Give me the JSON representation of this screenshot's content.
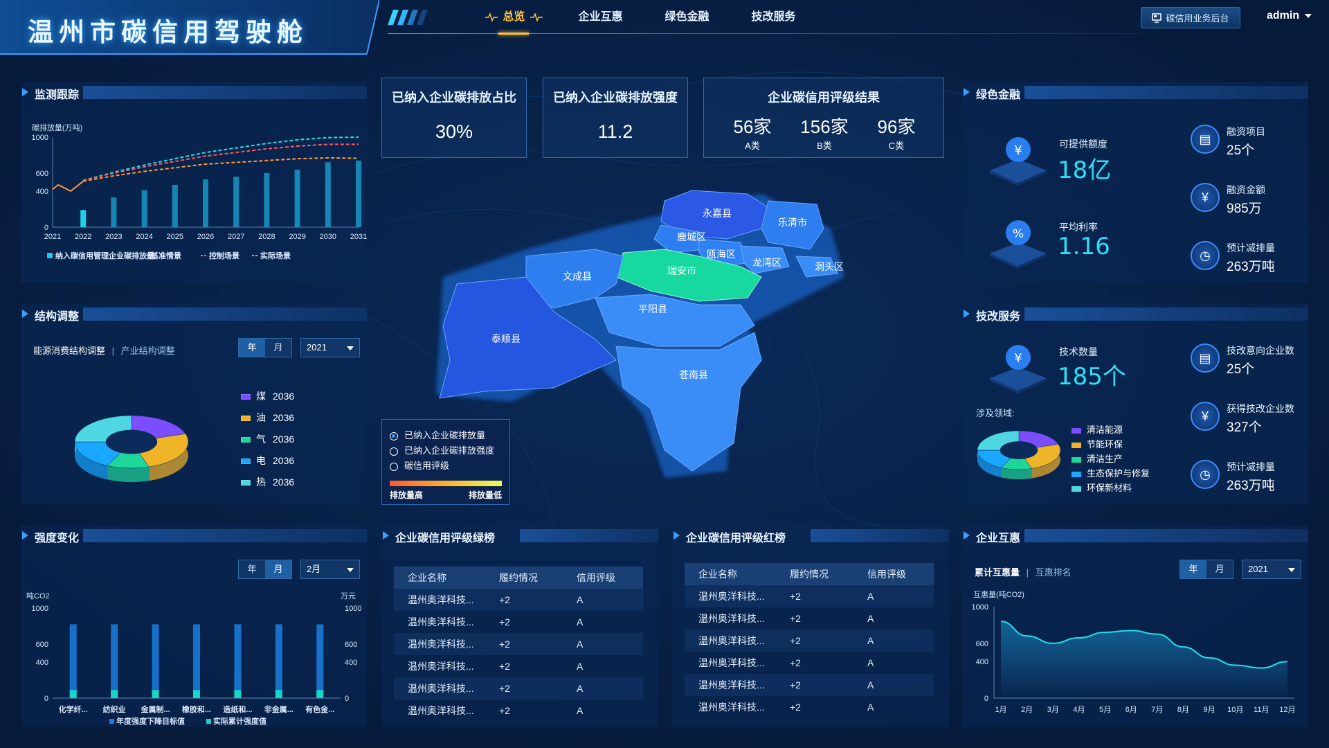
{
  "header": {
    "title": "温州市碳信用驾驶舱",
    "nav": [
      {
        "label": "总览",
        "active": true
      },
      {
        "label": "企业互惠",
        "active": false
      },
      {
        "label": "绿色金融",
        "active": false
      },
      {
        "label": "技改服务",
        "active": false
      }
    ],
    "backend_button": "碳信用业务后台",
    "user": "admin"
  },
  "monitor": {
    "title": "监测跟踪",
    "ylabel": "碳排放量(万吨)",
    "yticks": [
      "1000",
      "600",
      "400",
      "0"
    ],
    "legend": [
      "纳入碳信用管理企业碳排放量",
      "基准情景",
      "控制场景",
      "实际场景"
    ]
  },
  "structure": {
    "title": "结构调整",
    "tab_active": "能源消费结构调整",
    "tab_inactive": "产业结构调整",
    "toggle": [
      "年",
      "月"
    ],
    "year": "2021",
    "legend": [
      {
        "label": "煤",
        "year": "2036",
        "color": "#7b4dff"
      },
      {
        "label": "油",
        "year": "2036",
        "color": "#f0b429"
      },
      {
        "label": "气",
        "year": "2036",
        "color": "#1fd69a"
      },
      {
        "label": "电",
        "year": "2036",
        "color": "#1aa7ff"
      },
      {
        "label": "热",
        "year": "2036",
        "color": "#4fd6e3"
      }
    ]
  },
  "intensity": {
    "title": "强度变化",
    "toggle": [
      "年",
      "月"
    ],
    "month": "2月",
    "ylabel_left": "吨CO2",
    "ylabel_right": "万元",
    "yticks_left": [
      "1000",
      "600",
      "400",
      "0"
    ],
    "yticks_right": [
      "1000",
      "600",
      "400",
      "0"
    ],
    "legend": [
      "年度强度下降目标值",
      "实际累计强度值"
    ]
  },
  "stats": {
    "share": {
      "title": "已纳入企业碳排放占比",
      "value": "30%"
    },
    "intensity": {
      "title": "已纳入企业碳排放强度",
      "value": "11.2"
    },
    "rating": {
      "title": "企业碳信用评级结果",
      "items": [
        {
          "value": "56家",
          "label": "A类"
        },
        {
          "value": "156家",
          "label": "B类"
        },
        {
          "value": "96家",
          "label": "C类"
        }
      ]
    }
  },
  "map": {
    "regions": [
      "永嘉县",
      "乐清市",
      "鹿城区",
      "瓯海区",
      "龙湾区",
      "洞头区",
      "瑞安市",
      "文成县",
      "平阳县",
      "泰顺县",
      "苍南县"
    ],
    "legend_options": [
      {
        "label": "已纳入企业碳排放量",
        "selected": true
      },
      {
        "label": "已纳入企业碳排放强度",
        "selected": false
      },
      {
        "label": "碳信用评级",
        "selected": false
      }
    ],
    "gradient_high": "排放量高",
    "gradient_low": "排放量低"
  },
  "green_list": {
    "title": "企业碳信用评级绿榜",
    "headers": [
      "企业名称",
      "履约情况",
      "信用评级"
    ],
    "rows": [
      [
        "温州奥洋科技...",
        "+2",
        "A"
      ],
      [
        "温州奥洋科技...",
        "+2",
        "A"
      ],
      [
        "温州奥洋科技...",
        "+2",
        "A"
      ],
      [
        "温州奥洋科技...",
        "+2",
        "A"
      ],
      [
        "温州奥洋科技...",
        "+2",
        "A"
      ],
      [
        "温州奥洋科技...",
        "+2",
        "A"
      ]
    ]
  },
  "red_list": {
    "title": "企业碳信用评级红榜",
    "headers": [
      "企业名称",
      "履约情况",
      "信用评级"
    ],
    "rows": [
      [
        "温州奥洋科技...",
        "+2",
        "A"
      ],
      [
        "温州奥洋科技...",
        "+2",
        "A"
      ],
      [
        "温州奥洋科技...",
        "+2",
        "A"
      ],
      [
        "温州奥洋科技...",
        "+2",
        "A"
      ],
      [
        "温州奥洋科技...",
        "+2",
        "A"
      ],
      [
        "温州奥洋科技...",
        "+2",
        "A"
      ]
    ]
  },
  "green_finance": {
    "title": "绿色金融",
    "credit_label": "可提供额度",
    "credit_value": "18亿",
    "rate_label": "平均利率",
    "rate_value": "1.16",
    "projects_label": "融资项目",
    "projects_value": "25个",
    "amount_label": "融资金额",
    "amount_value": "985万",
    "reduction_label": "预计减排量",
    "reduction_value": "263万吨"
  },
  "tech_service": {
    "title": "技改服务",
    "count_label": "技术数量",
    "count_value": "185个",
    "fields_label": "涉及领域:",
    "fields": [
      {
        "label": "清洁能源",
        "color": "#7b4dff"
      },
      {
        "label": "节能环保",
        "color": "#f0b429"
      },
      {
        "label": "清洁生产",
        "color": "#1fd69a"
      },
      {
        "label": "生态保护与修复",
        "color": "#1aa7ff"
      },
      {
        "label": "环保新材料",
        "color": "#4fd6e3"
      }
    ],
    "intent_label": "技改意向企业数",
    "intent_value": "25个",
    "got_label": "获得技改企业数",
    "got_value": "327个",
    "reduction_label": "预计减排量",
    "reduction_value": "263万吨"
  },
  "mutual": {
    "title": "企业互惠",
    "tab_active": "累计互惠量",
    "tab_inactive": "互惠排名",
    "toggle": [
      "年",
      "月"
    ],
    "year": "2021",
    "ylabel": "互惠量(吨CO2)",
    "yticks": [
      "1000",
      "600",
      "400",
      "0"
    ]
  },
  "chart_data": [
    {
      "type": "line",
      "title": "监测跟踪",
      "ylabel": "碳排放量(万吨)",
      "x": [
        "2021",
        "2022",
        "2023",
        "2024",
        "2025",
        "2026",
        "2027",
        "2028",
        "2029",
        "2030",
        "2031"
      ],
      "ylim": [
        0,
        1000
      ],
      "series": [
        {
          "name": "纳入碳信用管理企业碳排放量",
          "kind": "bar",
          "color": "#1fc6e8",
          "values": [
            null,
            190,
            330,
            410,
            470,
            530,
            560,
            600,
            640,
            720,
            740
          ]
        },
        {
          "name": "基准情景",
          "kind": "line",
          "color": "#1fe0e8",
          "values": [
            null,
            520,
            610,
            690,
            760,
            830,
            880,
            930,
            970,
            995,
            1000
          ]
        },
        {
          "name": "控制场景",
          "kind": "line",
          "color": "#ff5a5a",
          "values": [
            null,
            520,
            600,
            670,
            730,
            790,
            830,
            870,
            900,
            920,
            920
          ]
        },
        {
          "name": "实际场景",
          "kind": "line",
          "color": "#ff9a3a",
          "values": [
            null,
            510,
            570,
            620,
            660,
            700,
            720,
            740,
            760,
            770,
            765
          ]
        },
        {
          "name": "实际场景-历史",
          "kind": "line",
          "color": "#ff9a3a",
          "values": [
            420,
            470,
            null,
            null,
            null,
            null,
            null,
            null,
            null,
            null,
            null
          ]
        }
      ]
    },
    {
      "type": "pie",
      "title": "能源消费结构调整",
      "categories": [
        "煤",
        "油",
        "气",
        "电",
        "热"
      ],
      "values": [
        20,
        25,
        12,
        18,
        25
      ],
      "colors": [
        "#7b4dff",
        "#f0b429",
        "#1fd69a",
        "#1aa7ff",
        "#4fd6e3"
      ]
    },
    {
      "type": "bar",
      "title": "强度变化",
      "categories": [
        "化学纤...",
        "纺织业",
        "金属制...",
        "橡胶和...",
        "造纸和...",
        "非金属...",
        "有色金..."
      ],
      "ylim": [
        0,
        1000
      ],
      "series": [
        {
          "name": "年度强度下降目标值",
          "color": "#1a7fe0",
          "values": [
            820,
            820,
            820,
            820,
            820,
            820,
            820
          ]
        },
        {
          "name": "实际累计强度值",
          "color": "#17d6c8",
          "values": [
            90,
            90,
            90,
            90,
            90,
            90,
            90
          ]
        }
      ]
    },
    {
      "type": "pie",
      "title": "涉及领域",
      "categories": [
        "清洁能源",
        "节能环保",
        "清洁生产",
        "生态保护与修复",
        "环保新材料"
      ],
      "values": [
        20,
        25,
        12,
        18,
        25
      ],
      "colors": [
        "#7b4dff",
        "#f0b429",
        "#1fd69a",
        "#1aa7ff",
        "#4fd6e3"
      ]
    },
    {
      "type": "area",
      "title": "企业互惠",
      "ylabel": "互惠量(吨CO2)",
      "x": [
        "1月",
        "2月",
        "3月",
        "4月",
        "5月",
        "6月",
        "7月",
        "8月",
        "9月",
        "10月",
        "11月",
        "12月"
      ],
      "ylim": [
        0,
        1000
      ],
      "series": [
        {
          "name": "累计互惠量",
          "color": "#1fe0e8",
          "values": [
            840,
            680,
            600,
            660,
            720,
            740,
            700,
            560,
            440,
            360,
            330,
            400
          ]
        }
      ]
    }
  ]
}
